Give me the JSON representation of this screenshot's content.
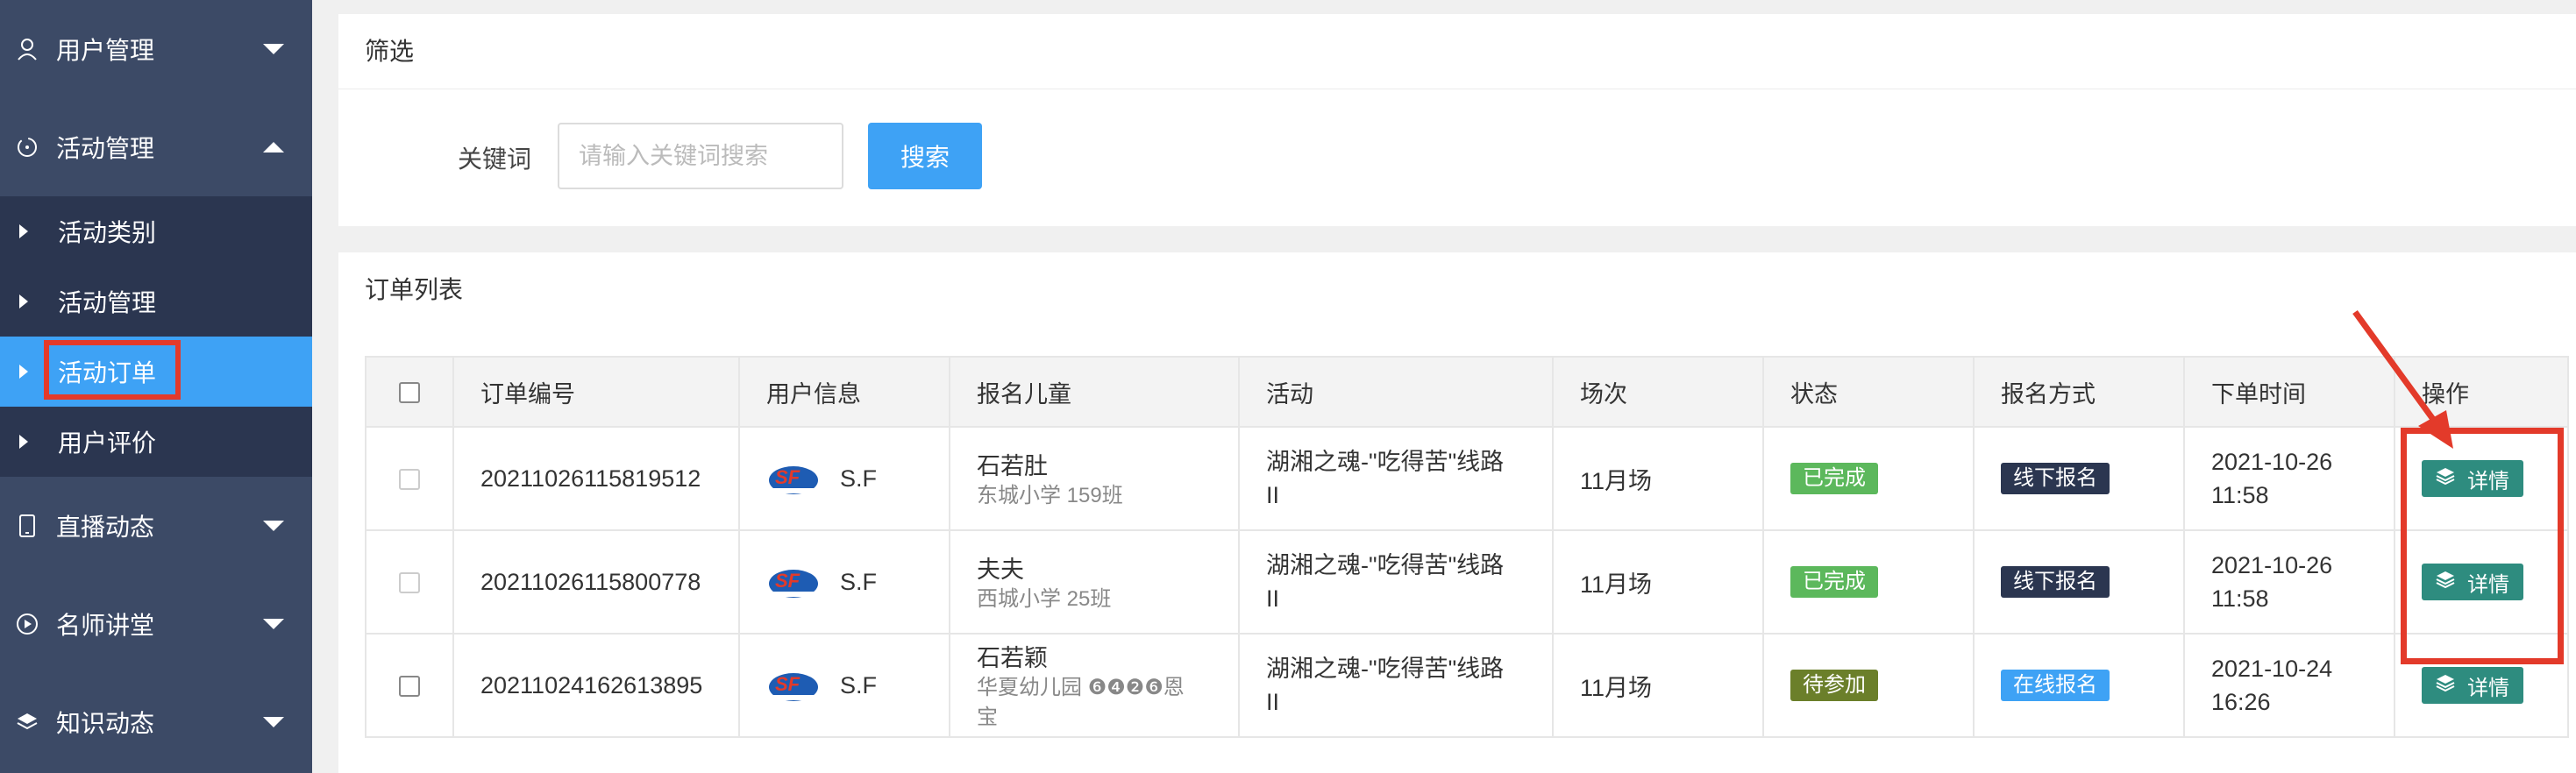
{
  "sidebar": {
    "groups": [
      {
        "label": "用户管理",
        "icon": "user-icon"
      },
      {
        "label": "活动管理",
        "icon": "activity-icon"
      },
      {
        "label": "直播动态",
        "icon": "phone-icon"
      },
      {
        "label": "名师讲堂",
        "icon": "play-circle-icon"
      },
      {
        "label": "知识动态",
        "icon": "layers-icon"
      }
    ],
    "sub_items": [
      {
        "label": "活动类别"
      },
      {
        "label": "活动管理"
      },
      {
        "label": "活动订单"
      },
      {
        "label": "用户评价"
      }
    ]
  },
  "filter": {
    "title": "筛选",
    "keyword_label": "关键词",
    "keyword_placeholder": "请输入关键词搜索",
    "keyword_value": "",
    "search_label": "搜索"
  },
  "orders": {
    "title": "订单列表",
    "columns": [
      "订单编号",
      "用户信息",
      "报名儿童",
      "活动",
      "场次",
      "状态",
      "报名方式",
      "下单时间",
      "操作"
    ],
    "rows": [
      {
        "order_no": "20211026115819512",
        "user": "S.F",
        "child_name": "石若肚",
        "child_school": "东城小学 159班",
        "activity_line1": "湖湘之魂-\"吃得苦\"线路",
        "activity_line2": "II",
        "session": "11月场",
        "status": "已完成",
        "method": "线下报名",
        "date": "2021-10-26",
        "time": "11:58",
        "action": "详情"
      },
      {
        "order_no": "20211026115800778",
        "user": "S.F",
        "child_name": "夫夫",
        "child_school": "西城小学 25班",
        "activity_line1": "湖湘之魂-\"吃得苦\"线路",
        "activity_line2": "II",
        "session": "11月场",
        "status": "已完成",
        "method": "线下报名",
        "date": "2021-10-26",
        "time": "11:58",
        "action": "详情"
      },
      {
        "order_no": "20211024162613895",
        "user": "S.F",
        "child_name": "石若颖",
        "child_school": "华夏幼儿园 ❻❹❷❻恩",
        "child_school2": "宝",
        "activity_line1": "湖湘之魂-\"吃得苦\"线路",
        "activity_line2": "II",
        "session": "11月场",
        "status": "待参加",
        "method": "在线报名",
        "date": "2021-10-24",
        "time": "16:26",
        "action": "详情"
      }
    ]
  },
  "colors": {
    "sidebar_bg": "#3c4a66",
    "sidebar_sub_bg": "#2b3650",
    "accent": "#3ea2f5",
    "status_done": "#5cb85c",
    "status_pending": "#6b7f2a",
    "method_offline": "#2b3650",
    "method_online": "#3ea2f5",
    "action_btn": "#2e8c7f",
    "annotation": "#e33a2a"
  }
}
